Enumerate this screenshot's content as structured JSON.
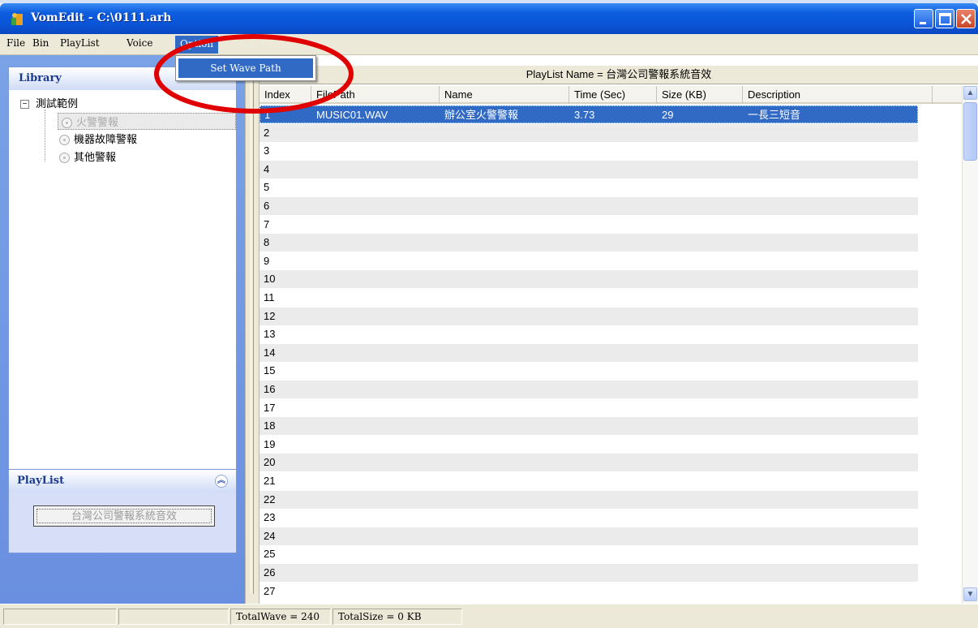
{
  "window": {
    "title": "VomEdit - C:\\0111.arh",
    "icon": "app-icon"
  },
  "menu": [
    {
      "label": "File"
    },
    {
      "label": "Bin"
    },
    {
      "label": "PlayList"
    },
    {
      "label": "Voice"
    },
    {
      "label": "Option"
    }
  ],
  "dropdown": {
    "items": [
      {
        "label": "Set Wave Path"
      }
    ]
  },
  "library": {
    "header": "Library",
    "tree": {
      "root": "測試範例",
      "children": [
        "火警警報",
        "機器故障警報",
        "其他警報"
      ]
    }
  },
  "playlist_panel": {
    "header": "PlayList",
    "button_label": "台灣公司警報系統音效"
  },
  "main": {
    "playlist_title": "PlayList Name = 台灣公司警報系統音效",
    "columns": [
      "Index",
      "FilePath",
      "Name",
      "Time (Sec)",
      "Size (KB)",
      "Description"
    ],
    "rows": [
      {
        "index": "1",
        "filepath": "MUSIC01.WAV",
        "name": "辦公室火警警報",
        "time": "3.73",
        "size": "29",
        "description": "一長三短音",
        "selected": true
      },
      {
        "index": "2"
      },
      {
        "index": "3"
      },
      {
        "index": "4"
      },
      {
        "index": "5"
      },
      {
        "index": "6"
      },
      {
        "index": "7"
      },
      {
        "index": "8"
      },
      {
        "index": "9"
      },
      {
        "index": "10"
      },
      {
        "index": "11"
      },
      {
        "index": "12"
      },
      {
        "index": "13"
      },
      {
        "index": "14"
      },
      {
        "index": "15"
      },
      {
        "index": "16"
      },
      {
        "index": "17"
      },
      {
        "index": "18"
      },
      {
        "index": "19"
      },
      {
        "index": "20"
      },
      {
        "index": "21"
      },
      {
        "index": "22"
      },
      {
        "index": "23"
      },
      {
        "index": "24"
      },
      {
        "index": "25"
      },
      {
        "index": "26"
      },
      {
        "index": "27"
      }
    ]
  },
  "status": {
    "total_wave": "TotalWave = 240",
    "total_size": "TotalSize = 0 KB"
  },
  "colors": {
    "titlebar": "#0a54d6",
    "selection": "#316ac5",
    "annotation": "#e00000"
  }
}
